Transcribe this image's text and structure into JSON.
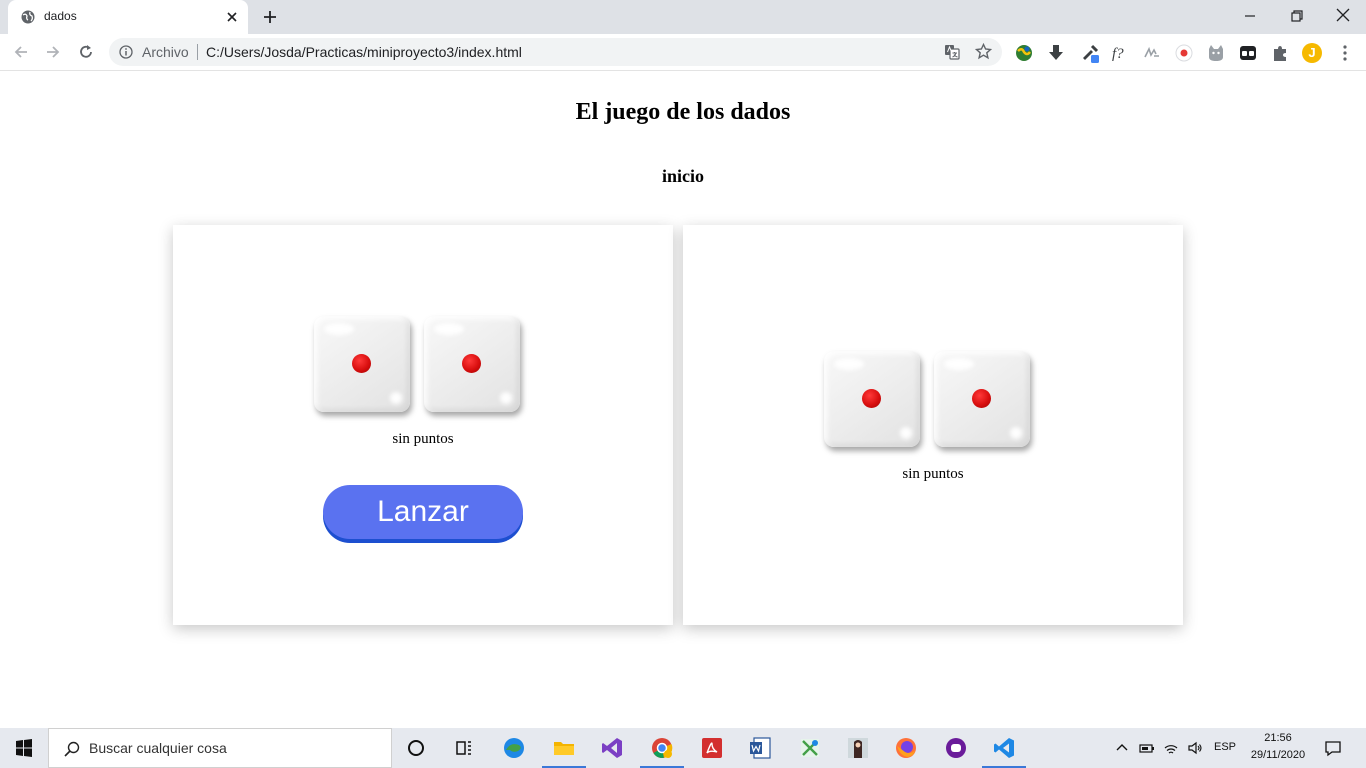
{
  "browser": {
    "tab_title": "dados",
    "scheme_label": "Archivo",
    "url": "C:/Users/Josda/Practicas/miniproyecto3/index.html",
    "profile_initial": "J"
  },
  "page": {
    "title": "El juego de los dados",
    "status": "inicio",
    "players": [
      {
        "dice": [
          1,
          1
        ],
        "points_text": "sin puntos",
        "roll_label": "Lanzar"
      },
      {
        "dice": [
          1,
          1
        ],
        "points_text": "sin puntos"
      }
    ]
  },
  "taskbar": {
    "search_placeholder": "Buscar cualquier cosa",
    "language": "ESP",
    "time": "21:56",
    "date": "29/11/2020"
  },
  "colors": {
    "button": "#5a72f0",
    "button_shadow": "#1d4fd0",
    "pip": "#d90f0f"
  }
}
